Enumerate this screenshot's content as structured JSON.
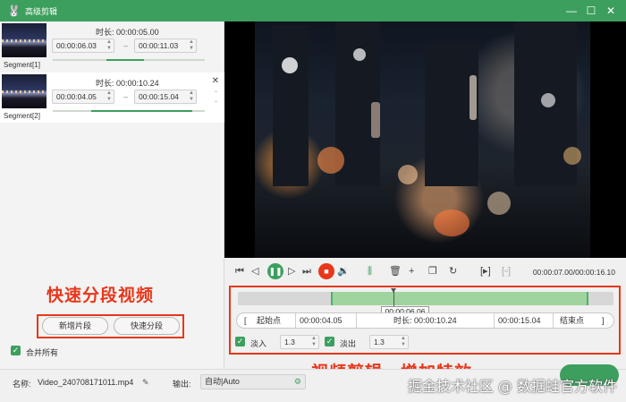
{
  "window": {
    "title": "高级剪辑",
    "app_icon": "🐰"
  },
  "segments": [
    {
      "label": "Segment[1]",
      "duration_label": "时长:",
      "duration": "00:00:05.00",
      "start": "00:00:06.03",
      "end": "00:00:11.03",
      "progress_start": 0.35,
      "progress_end": 0.6
    },
    {
      "label": "Segment[2]",
      "duration_label": "时长:",
      "duration": "00:00:10.24",
      "start": "00:00:04.05",
      "end": "00:00:15.04",
      "progress_start": 0.25,
      "progress_end": 0.92
    }
  ],
  "left_actions": {
    "new_clip": "新增片段",
    "quick_split": "快速分段",
    "merge_all": "合并所有"
  },
  "annotations": {
    "left": "快速分段视频",
    "right": "视频剪辑，增加特效",
    "watermark": "掘金技术社区 @ 数据蛙官方软件"
  },
  "player": {
    "time_readout": "00:00:07.00/00:00:16.10",
    "tooltip_time": "00:00:06.06",
    "playhead_fraction": 0.414,
    "range_start_fraction": 0.247,
    "range_end_fraction": 0.934
  },
  "trim": {
    "start_button": "起始点",
    "start_time": "00:00:04.05",
    "duration_label": "时长:",
    "duration": "00:00:10.24",
    "end_time": "00:00:15.04",
    "end_button": "结束点"
  },
  "effects": {
    "fade_in_label": "淡入",
    "fade_in_value": "1.3",
    "fade_out_label": "淡出",
    "fade_out_value": "1.3"
  },
  "bottom": {
    "name_label": "名称:",
    "file_name": "Video_240708171011.mp4",
    "output_label": "输出:",
    "output_value": "自动|Auto"
  },
  "colors": {
    "brand_green": "#3d9f5e",
    "annotation_red": "#e8371a"
  }
}
